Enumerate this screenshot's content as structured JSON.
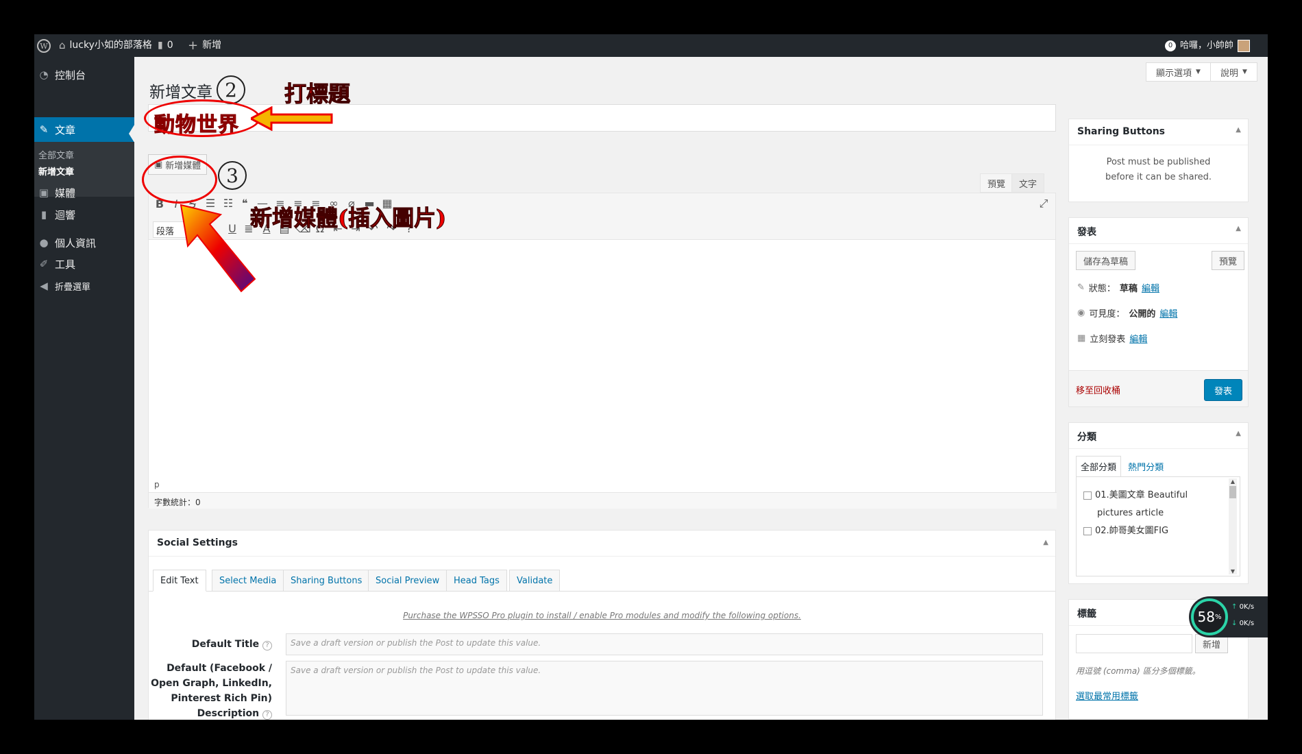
{
  "adminbar": {
    "site_name": "lucky小如的部落格",
    "comments_count": "0",
    "new_label": "新增",
    "notif_count": "0",
    "greeting": "哈囉，小帥帥"
  },
  "sidebar": {
    "items": [
      {
        "label": "控制台",
        "icon": "dashboard-icon"
      },
      {
        "label": "文章",
        "icon": "pin-icon"
      },
      {
        "label": "媒體",
        "icon": "media-icon"
      },
      {
        "label": "迴響",
        "icon": "comment-icon"
      },
      {
        "label": "個人資訊",
        "icon": "user-icon"
      },
      {
        "label": "工具",
        "icon": "wrench-icon"
      },
      {
        "label": "折疊選單",
        "icon": "collapse-icon"
      }
    ],
    "submenu": [
      "全部文章",
      "新增文章"
    ]
  },
  "topbuttons": {
    "screen_options": "顯示選項",
    "help": "說明"
  },
  "page_title": "新增文章",
  "post_title": "動物世界",
  "editor": {
    "add_media": "新增媒體",
    "tab_visual": "預覽",
    "tab_text": "文字",
    "format": "段落",
    "path": "p",
    "wordcount": "字數統計：0"
  },
  "social": {
    "title": "Social Settings",
    "tabs": [
      "Edit Text",
      "Select Media",
      "Sharing Buttons",
      "Social Preview",
      "Head Tags",
      "Validate"
    ],
    "purchase": "Purchase the WPSSO Pro plugin to install / enable Pro modules and modify the following options.",
    "default_title_label": "Default Title",
    "default_title_value": "Save a draft version or publish the Post to update this value.",
    "default_desc_label": "Default (Facebook / Open Graph, LinkedIn, Pinterest Rich Pin) Description",
    "default_desc_value": "Save a draft version or publish the Post to update this value."
  },
  "sharing_box": {
    "title": "Sharing Buttons",
    "message": "Post must be published before it can be shared."
  },
  "publish_box": {
    "title": "發表",
    "save_draft": "儲存為草稿",
    "preview": "預覽",
    "status_label": "狀態：",
    "status_value": "草稿",
    "visibility_label": "可見度：",
    "visibility_value": "公開的",
    "schedule_label": "立刻發表",
    "edit": "編輯",
    "trash": "移至回收桶",
    "publish": "發表"
  },
  "category_box": {
    "title": "分類",
    "tab_all": "全部分類",
    "tab_popular": "熱門分類",
    "items": [
      "01.美圖文章 Beautiful pictures article",
      "02.帥哥美女圖FIG"
    ]
  },
  "tags_box": {
    "title": "標籤",
    "add": "新增",
    "hint": "用逗號 (comma) 區分多個標籤。",
    "choose": "選取最常用標籤"
  },
  "speed_widget": {
    "percent": "58",
    "unit": "%",
    "up": "0K/s",
    "down": "0K/s"
  },
  "annotations": {
    "step2": "2",
    "step3": "3",
    "title_hint": "打標題",
    "media_hint": "新增媒體(插入圖片)"
  },
  "colors": {
    "accent": "#0073aa",
    "adminbar": "#23282d",
    "annotation": "#e00000"
  }
}
